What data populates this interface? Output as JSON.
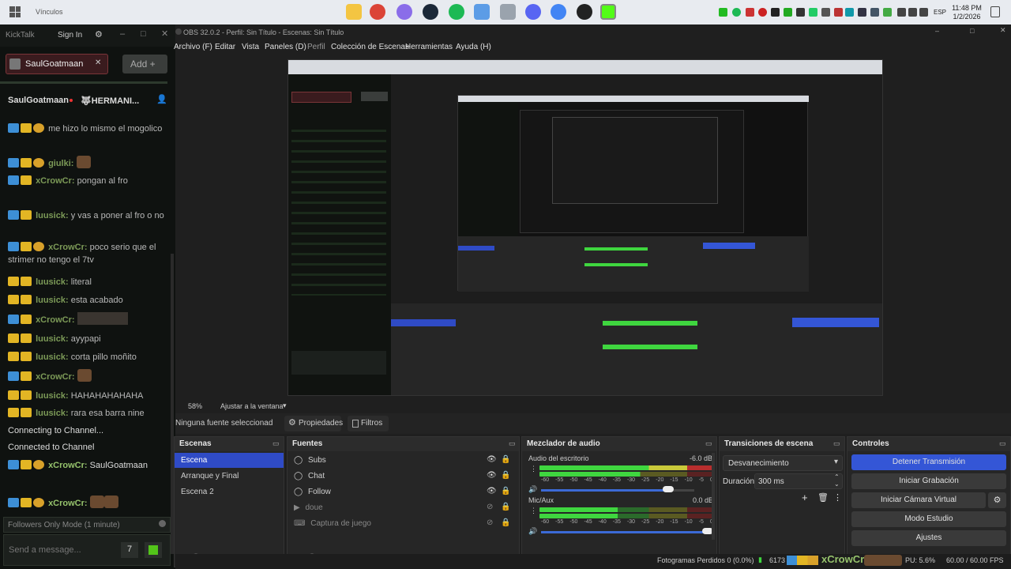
{
  "taskbar": {
    "window_title": "Vínculos",
    "lang": "ESP",
    "time": "11:48 PM",
    "date": "1/2/2026"
  },
  "kicktalk": {
    "app_name": "KickTalk",
    "sign_in": "Sign In",
    "tab_user": "SaulGoatmaan",
    "add_label": "Add +",
    "chat_header_user": "SaulGoatmaan",
    "chat_header_other": "🐺HERMANI...",
    "messages": [
      {
        "user": "",
        "text": "me hizo lo mismo el mogolico"
      },
      {
        "user": "giulki:",
        "text": ""
      },
      {
        "user": "xCrowCr:",
        "text": "pongan al fro"
      },
      {
        "user": "luusick:",
        "text": "y vas a poner al fro o no"
      },
      {
        "user": "xCrowCr:",
        "text": "poco serio que el strimer no tengo el 7tv"
      },
      {
        "user": "luusick:",
        "text": "literal"
      },
      {
        "user": "luusick:",
        "text": "esta acabado"
      },
      {
        "user": "xCrowCr:",
        "text": ""
      },
      {
        "user": "luusick:",
        "text": "ayypapi"
      },
      {
        "user": "luusick:",
        "text": "corta pillo moñito"
      },
      {
        "user": "xCrowCr:",
        "text": ""
      },
      {
        "user": "luusick:",
        "text": "HAHAHAHAHAHA"
      },
      {
        "user": "luusick:",
        "text": "rara esa barra nine"
      }
    ],
    "status_connecting": "Connecting to Channel...",
    "status_connected": "Connected to Channel",
    "sys_msg_user": "xCrowCr:",
    "sys_msg_text": "SaulGoatmaan",
    "last_user": "xCrowCr:",
    "followers_mode": "Followers Only Mode (1 minute)",
    "input_placeholder": "Send a message..."
  },
  "obs": {
    "title": "OBS 32.0.2 - Perfil: Sin Título - Escenas: Sin Título",
    "menu": [
      "Archivo (F)",
      "Editar",
      "Vista",
      "Paneles (D)",
      "Perfil",
      "Colección de Escenas",
      "Herramientas",
      "Ayuda (H)"
    ],
    "zoom": "58%",
    "fit": "Ajustar a la ventana",
    "no_source": "Ninguna fuente seleccionad",
    "properties": "Propiedades",
    "filters": "Filtros",
    "scenes_title": "Escenas",
    "scenes": [
      "Escena",
      "Arranque y Final",
      "Escena 2"
    ],
    "sources_title": "Fuentes",
    "sources": [
      "Subs",
      "Chat",
      "Follow",
      "doue",
      "Captura de juego"
    ],
    "mixer_title": "Mezclador de audio",
    "mixer": [
      {
        "name": "Audio del escritorio",
        "db": "-6.0 dB"
      },
      {
        "name": "Mic/Aux",
        "db": "0.0 dB"
      }
    ],
    "mixer_ticks": [
      "-60",
      "-55",
      "-50",
      "-45",
      "-40",
      "-35",
      "-30",
      "-25",
      "-20",
      "-15",
      "-10",
      "-5",
      "0"
    ],
    "transitions_title": "Transiciones de escena",
    "transition": "Desvanecimiento",
    "duration_label": "Duración",
    "duration": "300 ms",
    "controls_title": "Controles",
    "controls": [
      "Detener Transmisión",
      "Iniciar Grabación",
      "Iniciar Cámara Virtual",
      "Modo Estudio",
      "Ajustes"
    ],
    "status_frames": "Fotogramas Perdidos 0 (0.0%)",
    "status_bitrate": "6173",
    "status_cpu": "PU: 5.6%",
    "status_fps": "60.00 / 60.00 FPS",
    "overlay_name": "xCrowCr"
  }
}
